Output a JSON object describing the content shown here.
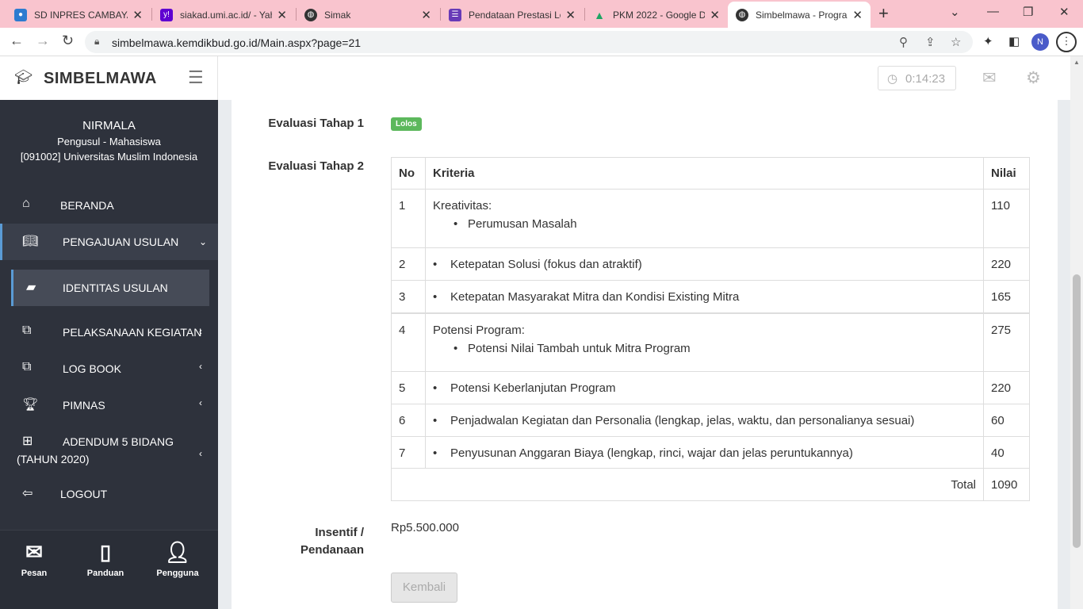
{
  "browser": {
    "tabs": [
      {
        "title": "SD INPRES CAMBAYA",
        "favicon": "kemdikbud-icon",
        "color": "#2d7bd0"
      },
      {
        "title": "siakad.umi.ac.id/ - Yah",
        "favicon": "yahoo-icon",
        "color": "#5f01d1"
      },
      {
        "title": "Simak",
        "favicon": "globe-icon",
        "color": "#333333"
      },
      {
        "title": "Pendataan Prestasi Lo",
        "favicon": "forms-icon",
        "color": "#673ab7"
      },
      {
        "title": "PKM 2022 - Google D",
        "favicon": "drive-icon",
        "color": "#1fa463"
      },
      {
        "title": "Simbelmawa - Progra",
        "favicon": "globe-icon",
        "color": "#333333",
        "active": true
      }
    ],
    "url": "simbelmawa.kemdikbud.go.id/Main.aspx?page=21",
    "profile_initial": "N"
  },
  "header": {
    "brand": "SIMBELMAWA",
    "timer": "0:14:23"
  },
  "user": {
    "name": "NIRMALA",
    "role": "Pengusul - Mahasiswa",
    "institution": "[091002] Universitas Muslim Indonesia"
  },
  "menu": [
    {
      "label": "BERANDA",
      "icon": "home-icon"
    },
    {
      "label": "PENGAJUAN USULAN",
      "icon": "book-open-icon",
      "expanded": true
    },
    {
      "label": "IDENTITAS USULAN",
      "icon": "book-icon",
      "active": true
    },
    {
      "label": "PELAKSANAAN KEGIATAN",
      "icon": "copy-icon"
    },
    {
      "label": "LOG BOOK",
      "icon": "copy-icon"
    },
    {
      "label": "PIMNAS",
      "icon": "trophy-icon"
    },
    {
      "label": "ADENDUM 5 BIDANG",
      "label2": "(TAHUN 2020)",
      "icon": "medkit-icon"
    },
    {
      "label": "LOGOUT",
      "icon": "logout-icon"
    }
  ],
  "bottom_bar": [
    {
      "label": "Pesan",
      "icon": "envelope-icon"
    },
    {
      "label": "Panduan",
      "icon": "notebook-icon"
    },
    {
      "label": "Pengguna",
      "icon": "user-icon"
    }
  ],
  "evaluation": {
    "stage1_label": "Evaluasi Tahap 1",
    "stage1_status": "Lolos",
    "stage2_label": "Evaluasi Tahap 2",
    "columns": [
      "No",
      "Kriteria",
      "Nilai"
    ],
    "rows": [
      {
        "no": "1",
        "group": "Kreativitas:",
        "criteria": "Perumusan Masalah",
        "value": "110"
      },
      {
        "no": "2",
        "criteria": "Ketepatan Solusi (fokus dan atraktif)",
        "value": "220"
      },
      {
        "no": "3",
        "criteria": "Ketepatan Masyarakat Mitra dan Kondisi Existing Mitra",
        "value": "165"
      },
      {
        "no": "4",
        "group": "Potensi Program:",
        "criteria": "Potensi Nilai Tambah untuk Mitra Program",
        "value": "275"
      },
      {
        "no": "5",
        "criteria": "Potensi Keberlanjutan Program",
        "value": "220"
      },
      {
        "no": "6",
        "criteria": "Penjadwalan Kegiatan dan Personalia (lengkap, jelas, waktu, dan personalianya sesuai)",
        "value": "60"
      },
      {
        "no": "7",
        "criteria": "Penyusunan Anggaran Biaya (lengkap, rinci, wajar dan jelas peruntukannya)",
        "value": "40"
      }
    ],
    "total_label": "Total",
    "total_value": "1090"
  },
  "funding": {
    "label_line1": "Insentif /",
    "label_line2": "Pendanaan",
    "value": "Rp5.500.000"
  },
  "back_button": "Kembali"
}
